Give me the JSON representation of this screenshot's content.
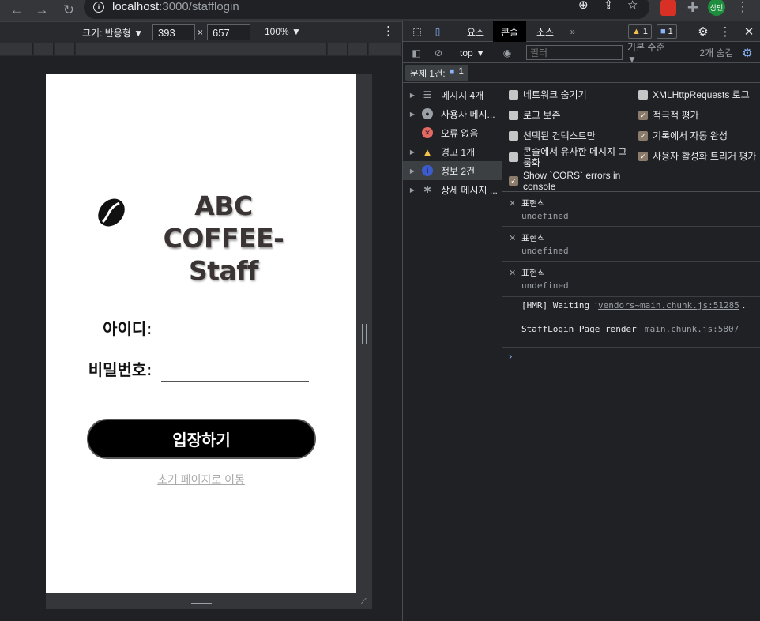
{
  "browser": {
    "url_host": "localhost",
    "url_path": ":3000/stafflogin",
    "profile_initials": "상민"
  },
  "device_toolbar": {
    "size_label": "크기: 반응형 ▼",
    "width": "393",
    "times": "×",
    "height": "657",
    "zoom": "100% ▼"
  },
  "login_page": {
    "brand_line1": "ABC COFFEE-",
    "brand_line2": "Staff",
    "id_label": "아이디:",
    "password_label": "비밀번호:",
    "id_value": "",
    "password_value": "",
    "login_button": "입장하기",
    "home_link": "초기 페이지로 이동"
  },
  "devtools": {
    "tabs": [
      "요소",
      "콘솔",
      "소스"
    ],
    "more_tabs": "»",
    "warning_count": "1",
    "info_count": "1",
    "context": "top ▼",
    "filter_placeholder": "필터",
    "level": "기본 수준 ▼",
    "hidden_count": "2개 숨김",
    "issues": "문제 1건:",
    "issues_count": "1",
    "sidebar": [
      {
        "label": "메시지 4개",
        "icon": "list-icon"
      },
      {
        "label": "사용자 메시...",
        "icon": "user-icon"
      },
      {
        "label": "오류 없음",
        "icon": "error-icon"
      },
      {
        "label": "경고 1개",
        "icon": "warning-icon"
      },
      {
        "label": "정보 2건",
        "icon": "info-icon"
      },
      {
        "label": "상세 메시지 ...",
        "icon": "bug-icon"
      }
    ],
    "options_left": [
      {
        "label": "네트워크 숨기기",
        "checked": false
      },
      {
        "label": "로그 보존",
        "checked": false
      },
      {
        "label": "선택된 컨텍스트만",
        "checked": false
      },
      {
        "label": "콘솔에서 유사한 메시지 그룹화",
        "checked": false
      },
      {
        "label": "Show `CORS` errors in console",
        "checked": true
      }
    ],
    "options_right": [
      {
        "label": "XMLHttpRequests 로그",
        "checked": false
      },
      {
        "label": "적극적 평가",
        "checked": true
      },
      {
        "label": "기록에서 자동 완성",
        "checked": true
      },
      {
        "label": "사용자 활성화 트리거 평가",
        "checked": true
      }
    ],
    "expressions": [
      {
        "label": "표현식",
        "value": "undefined"
      },
      {
        "label": "표현식",
        "value": "undefined"
      },
      {
        "label": "표현식",
        "value": "undefined"
      }
    ],
    "messages": [
      {
        "text": "[HMR] Waiting for update signal from WDS...",
        "source": "vendors~main.chunk.js:51285"
      },
      {
        "text": "StaffLogin Page render ...",
        "source": "main.chunk.js:5807"
      }
    ],
    "prompt": "›"
  }
}
